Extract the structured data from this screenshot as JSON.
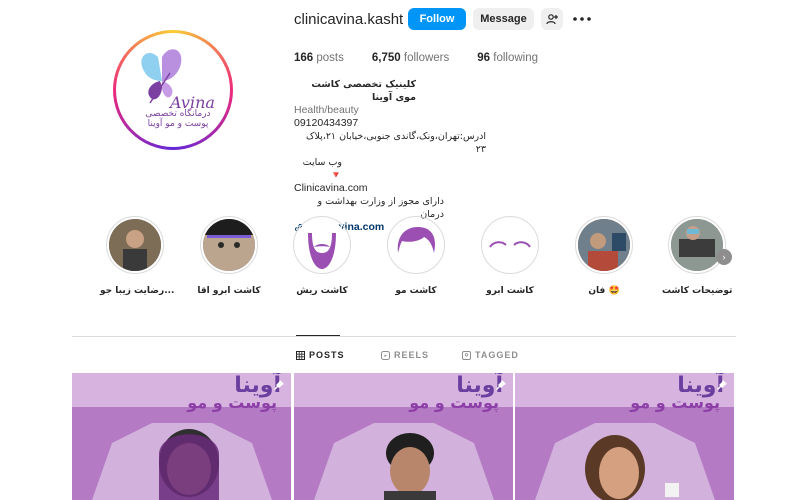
{
  "profile": {
    "username": "clinicavina.kasht",
    "follow_label": "Follow",
    "message_label": "Message",
    "logo_word": "Avina",
    "logo_sub": "درمانگاه تخصصی پوست و مو آوینا"
  },
  "stats": {
    "posts_num": "166",
    "posts_lbl": "posts",
    "followers_num": "6,750",
    "followers_lbl": "followers",
    "following_num": "96",
    "following_lbl": "following"
  },
  "bio": {
    "name": "کلینیک تخصصی کاشت موی آوینا",
    "category": "Health/beauty",
    "phone": "09120434397",
    "address": "ادرس:تهران،ونک،گاندی جنوبی،خیابان ۲۱،پلاک ۲۳",
    "website_label": "وب سایت 🔻",
    "site_text": "Clinicavina.com",
    "license": "دارای مجوز از وزارت بهداشت و درمان",
    "link": "clinicavina.com"
  },
  "highlights": [
    {
      "label": "رضایت زیبا جو..."
    },
    {
      "label": "کاشت ابرو اقا"
    },
    {
      "label": "کاشت ریش"
    },
    {
      "label": "کاشت مو"
    },
    {
      "label": "کاشت ابرو"
    },
    {
      "label": "فان 🤩"
    },
    {
      "label": "توضیحات کاشت"
    }
  ],
  "tabs": {
    "posts": "POSTS",
    "reels": "REELS",
    "tagged": "TAGGED"
  },
  "posts": [
    {
      "line1": "آوینا",
      "line2": "پوست و مو"
    },
    {
      "line1": "آوینا",
      "line2": "پوست و مو"
    },
    {
      "line1": "آوینا",
      "line2": "پوست و مو"
    }
  ],
  "colors": {
    "accent": "#0095f6",
    "brand_purple": "#7b3fa1",
    "post_bg": "#b57ac4"
  }
}
